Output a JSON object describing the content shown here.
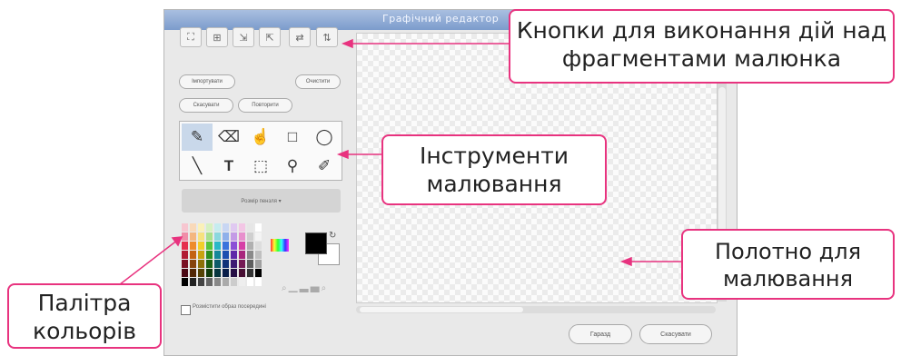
{
  "window": {
    "title": "Графічний редактор"
  },
  "toolbar_buttons": [
    "group-icon",
    "ungroup-icon",
    "import-icon",
    "export-icon",
    "flip-horizontal-icon",
    "flip-vertical-icon"
  ],
  "actions": {
    "import_label": "Імпортувати",
    "clear_label": "Очистити",
    "undo_label": "Скасувати",
    "redo_label": "Повторити"
  },
  "tools": [
    "brush-icon",
    "eraser-icon",
    "fill-icon",
    "rectangle-icon",
    "ellipse-icon",
    "line-icon",
    "text-icon",
    "select-icon",
    "stamp-icon",
    "eyedropper-icon"
  ],
  "brush_size_label": "Розмір пензля ▾",
  "colors": {
    "accent": "#e8337f",
    "primary": "#000000",
    "secondary": "#ffffff"
  },
  "center_checkbox_label": "Розмістити образ посередині",
  "footer": {
    "ok_label": "Гаразд",
    "cancel_label": "Скасувати"
  },
  "callouts": {
    "action_buttons": "Кнопки для виконання дій над фрагментами малюнка",
    "drawing_tools": "Інструменти малювання",
    "canvas": "Полотно для малювання",
    "palette": "Палітра кольорів"
  }
}
